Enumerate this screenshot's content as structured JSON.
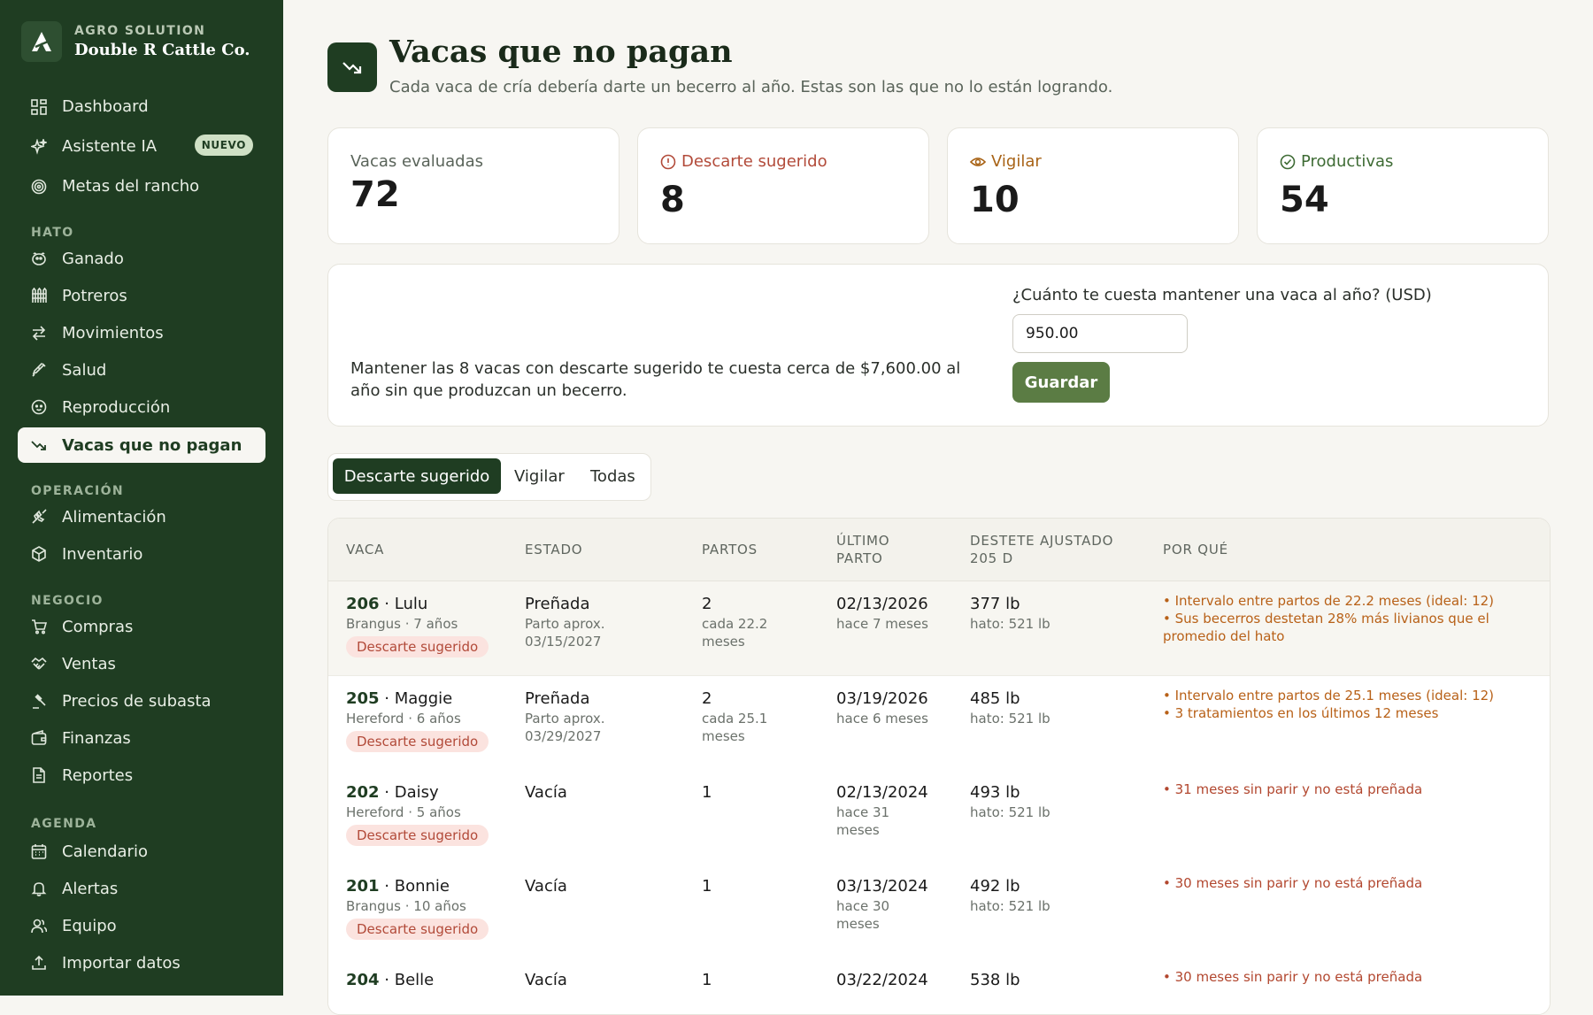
{
  "brand": {
    "kicker": "AGRO SOLUTION",
    "name": "Double R Cattle Co."
  },
  "nav": {
    "dashboard": "Dashboard",
    "assistant": "Asistente IA",
    "assistant_badge": "NUEVO",
    "goals": "Metas del rancho",
    "section_hato": "HATO",
    "ganado": "Ganado",
    "potreros": "Potreros",
    "movimientos": "Movimientos",
    "salud": "Salud",
    "reproduccion": "Reproducción",
    "vacas": "Vacas que no pagan",
    "section_operacion": "OPERACIÓN",
    "alimentacion": "Alimentación",
    "inventario": "Inventario",
    "section_negocio": "NEGOCIO",
    "compras": "Compras",
    "ventas": "Ventas",
    "precios": "Precios de subasta",
    "finanzas": "Finanzas",
    "reportes": "Reportes",
    "section_agenda": "AGENDA",
    "calendario": "Calendario",
    "alertas": "Alertas",
    "equipo": "Equipo",
    "importar": "Importar datos"
  },
  "header": {
    "title": "Vacas que no pagan",
    "subtitle": "Cada vaca de cría debería darte un becerro al año. Estas son las que no lo están logrando."
  },
  "stats": {
    "evaluated_label": "Vacas evaluadas",
    "evaluated_value": "72",
    "cull_label": "Descarte sugerido",
    "cull_value": "8",
    "watch_label": "Vigilar",
    "watch_value": "10",
    "productive_label": "Productivas",
    "productive_value": "54"
  },
  "cost": {
    "message": "Mantener las 8 vacas con descarte sugerido te cuesta cerca de $7,600.00 al año sin que produzcan un becerro.",
    "label": "¿Cuánto te cuesta mantener una vaca al año? (USD)",
    "value": "950.00",
    "save": "Guardar"
  },
  "tabs": {
    "cull": "Descarte sugerido",
    "watch": "Vigilar",
    "all": "Todas"
  },
  "table": {
    "headers": {
      "vaca": "VACA",
      "estado": "ESTADO",
      "partos": "PARTOS",
      "ultimo_1": "ÚLTIMO",
      "ultimo_2": "PARTO",
      "destete_1": "DESTETE AJUSTADO",
      "destete_2": "205 D",
      "porque": "POR QUÉ"
    },
    "rows": [
      {
        "id": "206",
        "name": " · Lulu",
        "breed": "Brangus · 7 años",
        "badge": "Descarte sugerido",
        "estado": "Preñada",
        "estado_sub_1": "Parto aprox.",
        "estado_sub_2": "03/15/2027",
        "partos": "2",
        "partos_sub_1": "cada 22.2",
        "partos_sub_2": "meses",
        "ultimo": "02/13/2026",
        "ultimo_sub_1": "hace 7 meses",
        "ultimo_sub_2": "",
        "destete": "377 lb",
        "destete_sub": "hato: 521 lb",
        "reasons": [
          "• Intervalo entre partos de 22.2 meses (ideal: 12)",
          "• Sus becerros destetan 28% más livianos que el",
          "promedio del hato"
        ]
      },
      {
        "id": "205",
        "name": " · Maggie",
        "breed": "Hereford · 6 años",
        "badge": "Descarte sugerido",
        "estado": "Preñada",
        "estado_sub_1": "Parto aprox.",
        "estado_sub_2": "03/29/2027",
        "partos": "2",
        "partos_sub_1": "cada 25.1",
        "partos_sub_2": "meses",
        "ultimo": "03/19/2026",
        "ultimo_sub_1": "hace 6 meses",
        "ultimo_sub_2": "",
        "destete": "485 lb",
        "destete_sub": "hato: 521 lb",
        "reasons": [
          "• Intervalo entre partos de 25.1 meses (ideal: 12)",
          "• 3 tratamientos en los últimos 12 meses",
          ""
        ]
      },
      {
        "id": "202",
        "name": " · Daisy",
        "breed": "Hereford · 5 años",
        "badge": "Descarte sugerido",
        "estado": "Vacía",
        "estado_sub_1": "",
        "estado_sub_2": "",
        "partos": "1",
        "partos_sub_1": "",
        "partos_sub_2": "",
        "ultimo": "02/13/2024",
        "ultimo_sub_1": "hace 31",
        "ultimo_sub_2": "meses",
        "destete": "493 lb",
        "destete_sub": "hato: 521 lb",
        "reasons": [
          "• 31 meses sin parir y no está preñada",
          "",
          ""
        ]
      },
      {
        "id": "201",
        "name": " · Bonnie",
        "breed": "Brangus · 10 años",
        "badge": "Descarte sugerido",
        "estado": "Vacía",
        "estado_sub_1": "",
        "estado_sub_2": "",
        "partos": "1",
        "partos_sub_1": "",
        "partos_sub_2": "",
        "ultimo": "03/13/2024",
        "ultimo_sub_1": "hace 30",
        "ultimo_sub_2": "meses",
        "destete": "492 lb",
        "destete_sub": "hato: 521 lb",
        "reasons": [
          "• 30 meses sin parir y no está preñada",
          "",
          ""
        ]
      },
      {
        "id": "204",
        "name": " · Belle",
        "breed": "",
        "badge": "",
        "estado": "Vacía",
        "estado_sub_1": "",
        "estado_sub_2": "",
        "partos": "1",
        "partos_sub_1": "",
        "partos_sub_2": "",
        "ultimo": "03/22/2024",
        "ultimo_sub_1": "",
        "ultimo_sub_2": "",
        "destete": "538 lb",
        "destete_sub": "",
        "reasons": [
          "• 30 meses sin parir y no está preñada",
          "",
          ""
        ]
      }
    ]
  }
}
